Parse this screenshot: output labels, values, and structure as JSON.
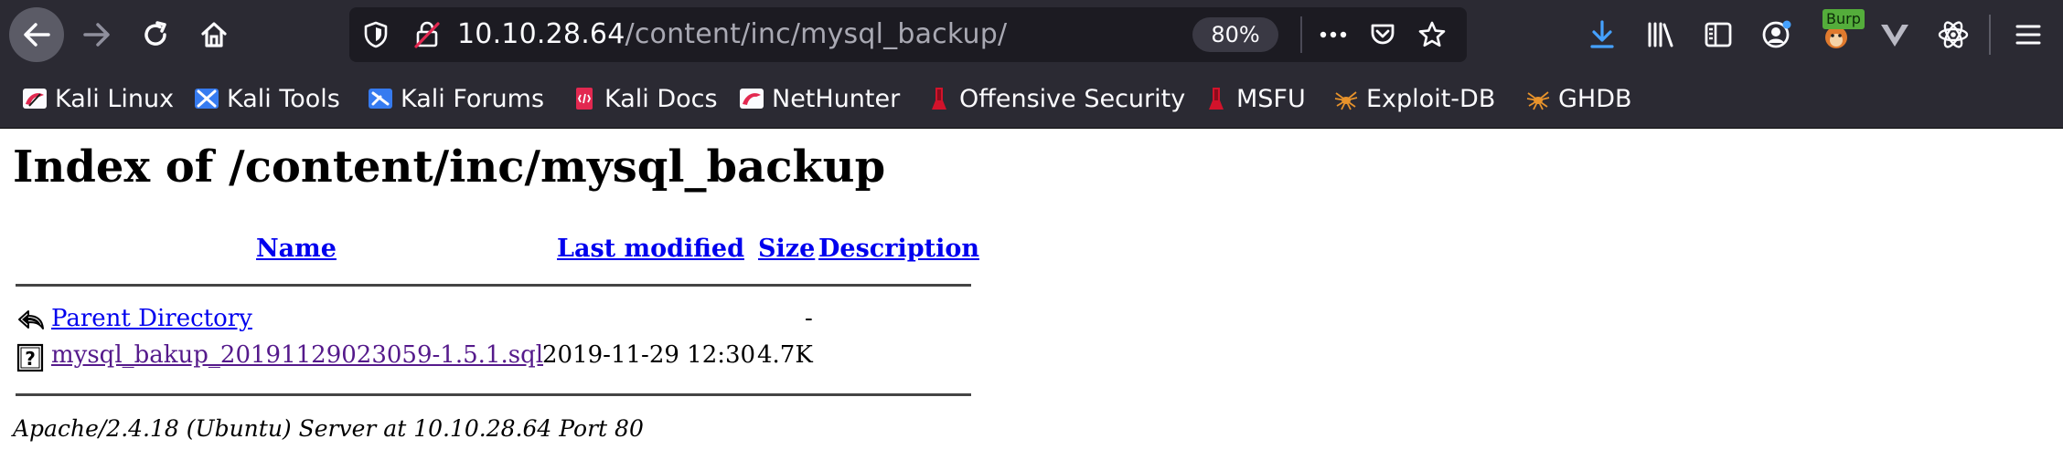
{
  "browser": {
    "url_host": "10.10.28.64",
    "url_path": "/content/inc/mysql_backup/",
    "zoom": "80%",
    "burp_badge": "Burp",
    "colors": {
      "toolbar_bg": "#2b2a33",
      "urlbar_bg": "#1c1b22",
      "download_accent": "#45a1ff"
    }
  },
  "bookmarks": [
    {
      "label": "Kali Linux",
      "icon": "kali-dragon-icon"
    },
    {
      "label": "Kali Tools",
      "icon": "kali-tools-icon"
    },
    {
      "label": "Kali Forums",
      "icon": "kali-forums-icon"
    },
    {
      "label": "Kali Docs",
      "icon": "kali-docs-icon"
    },
    {
      "label": "NetHunter",
      "icon": "nethunter-icon"
    },
    {
      "label": "Offensive Security",
      "icon": "offsec-icon"
    },
    {
      "label": "MSFU",
      "icon": "msfu-icon"
    },
    {
      "label": "Exploit-DB",
      "icon": "exploitdb-spider-icon"
    },
    {
      "label": "GHDB",
      "icon": "ghdb-spider-icon"
    }
  ],
  "page": {
    "title": "Index of /content/inc/mysql_backup",
    "columns": {
      "name": "Name",
      "last_modified": "Last modified",
      "size": "Size",
      "description": "Description"
    },
    "rows": [
      {
        "name": "Parent Directory",
        "last_modified": "",
        "size": "-",
        "description": "",
        "icon": "back-arrow-icon"
      },
      {
        "name": "mysql_bakup_20191129023059-1.5.1.sql",
        "last_modified": "2019-11-29 12:30",
        "size": "4.7K",
        "description": "",
        "icon": "unknown-file-icon"
      }
    ],
    "footer": "Apache/2.4.18 (Ubuntu) Server at 10.10.28.64 Port 80",
    "colors": {
      "link": "#0000ee",
      "visited_link": "#551a8b"
    }
  }
}
